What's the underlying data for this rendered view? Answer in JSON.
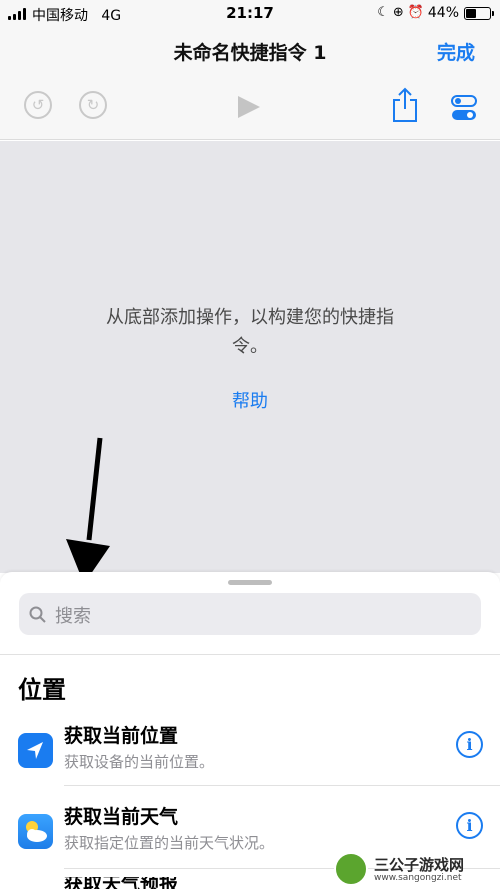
{
  "status_bar": {
    "carrier": "中国移动",
    "network": "4G",
    "time": "21:17",
    "battery_percent": "44%",
    "battery_level": 0.44,
    "icons": [
      "moon-icon",
      "orientation-lock-icon",
      "alarm-icon"
    ]
  },
  "nav": {
    "title": "未命名快捷指令 1",
    "done_label": "完成",
    "toolbar_icons": [
      "undo-icon",
      "redo-icon",
      "play-icon",
      "share-icon",
      "settings-toggle-icon"
    ]
  },
  "editor": {
    "empty_message": "从底部添加操作，以构建您的快捷指令。",
    "help_label": "帮助"
  },
  "sheet": {
    "search_placeholder": "搜索",
    "section_title": "位置",
    "actions": [
      {
        "title": "获取当前位置",
        "subtitle": "获取设备的当前位置。",
        "icon": "location-arrow-icon"
      },
      {
        "title": "获取当前天气",
        "subtitle": "获取指定位置的当前天气状况。",
        "icon": "weather-icon"
      },
      {
        "title": "获取天气预报",
        "subtitle": "",
        "icon": ""
      }
    ]
  },
  "watermark": {
    "text": "三公子游戏网",
    "url": "www.sangongzi.net"
  },
  "colors": {
    "accent": "#1a7cf0",
    "editor_background": "#e6e6ea",
    "bar_background": "#f7f7f7"
  }
}
